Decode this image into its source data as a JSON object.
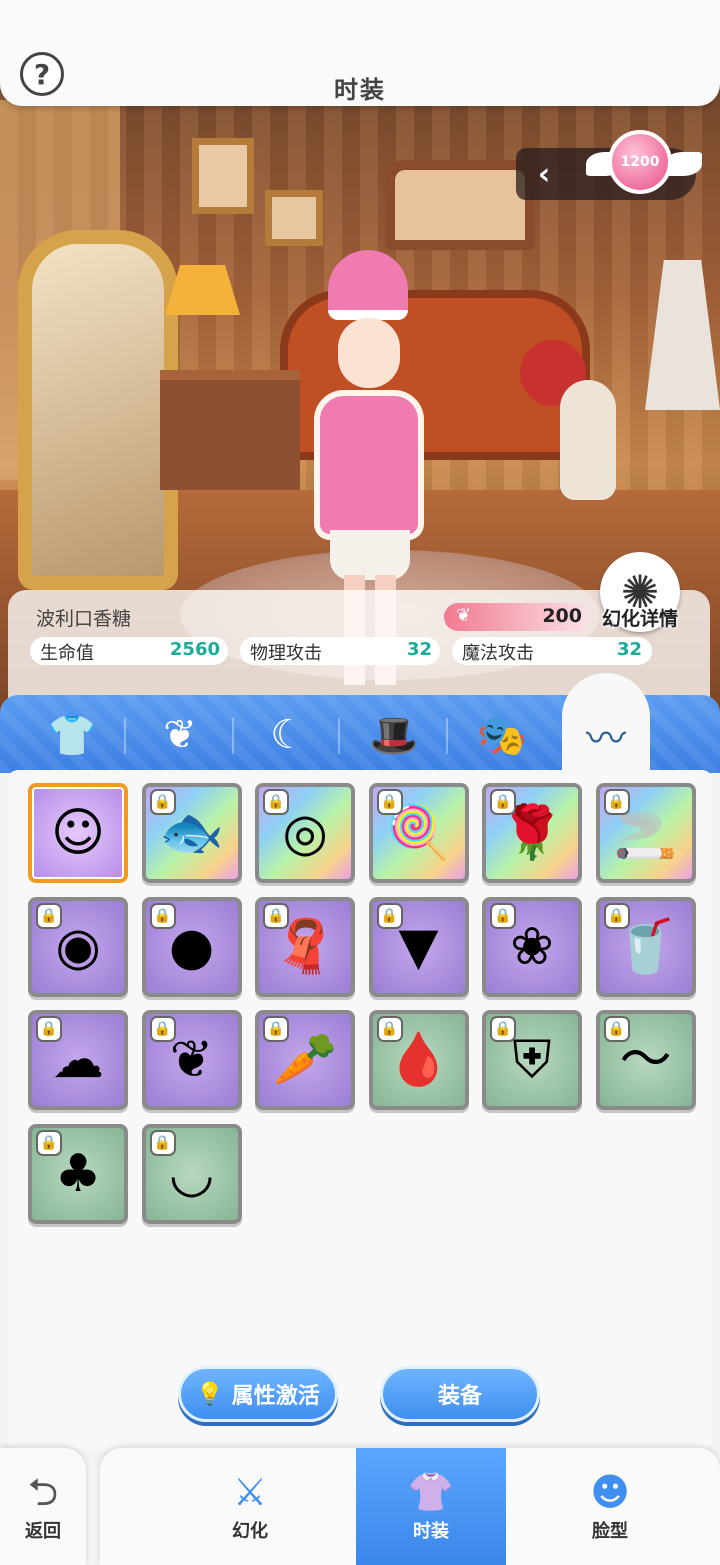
{
  "header": {
    "title": "时装",
    "help_glyph": "?"
  },
  "currency": {
    "amount": "1200"
  },
  "costume": {
    "name": "波利口香糖",
    "power": "200",
    "illusion_detail_label": "幻化详情",
    "stats": [
      {
        "label": "生命值",
        "value": "2560"
      },
      {
        "label": "物理攻击",
        "value": "32"
      },
      {
        "label": "魔法攻击",
        "value": "32"
      }
    ]
  },
  "tabs": [
    {
      "icon": "shirt-icon"
    },
    {
      "icon": "wings-icon"
    },
    {
      "icon": "tail-icon"
    },
    {
      "icon": "hat-icon"
    },
    {
      "icon": "mask-icon"
    },
    {
      "icon": "mustache-icon",
      "active": true
    }
  ],
  "items": [
    {
      "icon": "poring-face-icon",
      "bg": "selected",
      "locked": false
    },
    {
      "icon": "fish-icon",
      "bg": "rainbow",
      "locked": true
    },
    {
      "icon": "donut-icon",
      "bg": "rainbow",
      "locked": true
    },
    {
      "icon": "lollipop-icon",
      "bg": "rainbow",
      "locked": true
    },
    {
      "icon": "rose-icon",
      "bg": "rainbow",
      "locked": true
    },
    {
      "icon": "pipe-icon",
      "bg": "rainbow",
      "locked": true
    },
    {
      "icon": "pacifier-icon",
      "bg": "purple",
      "locked": true
    },
    {
      "icon": "bubble-gum-icon",
      "bg": "purple",
      "locked": true
    },
    {
      "icon": "rainbow-scarf-icon",
      "bg": "purple",
      "locked": true
    },
    {
      "icon": "spiked-mask-icon",
      "bg": "purple",
      "locked": true
    },
    {
      "icon": "white-rose-icon",
      "bg": "purple",
      "locked": true
    },
    {
      "icon": "drink-can-icon",
      "bg": "purple",
      "locked": true
    },
    {
      "icon": "smoke-icon",
      "bg": "purple",
      "locked": true
    },
    {
      "icon": "white-feather-icon",
      "bg": "purple",
      "locked": true
    },
    {
      "icon": "carrot-icon",
      "bg": "purple",
      "locked": true
    },
    {
      "icon": "blood-bag-icon",
      "bg": "green",
      "locked": true
    },
    {
      "icon": "armor-mask-icon",
      "bg": "green",
      "locked": true
    },
    {
      "icon": "brows-icon",
      "bg": "green",
      "locked": true
    },
    {
      "icon": "beard-icon",
      "bg": "green",
      "locked": true
    },
    {
      "icon": "grin-icon",
      "bg": "green",
      "locked": true
    }
  ],
  "buttons": {
    "activate_label": "属性激活",
    "equip_label": "装备"
  },
  "bottom_nav": [
    {
      "label": "返回",
      "icon": "back-arrow-icon"
    },
    {
      "label": "幻化",
      "icon": "sword-icon"
    },
    {
      "label": "时装",
      "icon": "outfit-icon",
      "active": true
    },
    {
      "label": "脸型",
      "icon": "face-icon"
    }
  ],
  "colors": {
    "accent": "#3f8ff0",
    "selected_border": "#f39a1e",
    "stat_value": "#1bab9a",
    "power_bar": "#f27a90"
  }
}
